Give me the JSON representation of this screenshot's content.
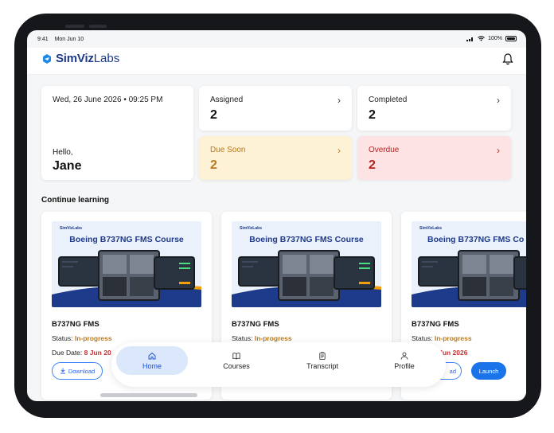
{
  "statusbar": {
    "time": "9:41",
    "date": "Mon Jun 10",
    "battery": "100%"
  },
  "header": {
    "brand_bold": "SimViz",
    "brand_light": "Labs",
    "bell_icon": "bell-icon"
  },
  "summary": {
    "datetime": "Wed, 26 June 2026 • 09:25 PM",
    "greeting": "Hello,",
    "user_name": "Jane",
    "assigned": {
      "label": "Assigned",
      "value": "2"
    },
    "completed": {
      "label": "Completed",
      "value": "2"
    },
    "due_soon": {
      "label": "Due Soon",
      "value": "2"
    },
    "overdue": {
      "label": "Overdue",
      "value": "2"
    }
  },
  "section_title": "Continue learning",
  "courses": [
    {
      "thumb_logo": "SimVizLabs",
      "thumb_title": "Boeing B737NG FMS Course",
      "title": "B737NG FMS",
      "status_label": "Status:",
      "status": "In-progress",
      "due_label": "Due Date:",
      "due": "8 Jun 20",
      "download": "Download",
      "launch": ""
    },
    {
      "thumb_logo": "SimVizLabs",
      "thumb_title": "Boeing B737NG FMS Course",
      "title": "B737NG FMS",
      "status_label": "Status:",
      "status": "In-progress",
      "due_label": "",
      "due": "",
      "download": "",
      "launch": ""
    },
    {
      "thumb_logo": "SimVizLabs",
      "thumb_title": "Boeing B737NG FMS Co",
      "title": "B737NG FMS",
      "status_label": "Status:",
      "status": "In-progress",
      "due_label": "",
      "due": "8 Jun 2026",
      "download": "ad",
      "launch": "Launch"
    }
  ],
  "nav": {
    "home": "Home",
    "courses": "Courses",
    "transcript": "Transcript",
    "profile": "Profile"
  },
  "colors": {
    "accent": "#1a73e8",
    "due_soon_bg": "#fdf1d6",
    "overdue_bg": "#fde3e3",
    "brand": "#1e3a8a"
  }
}
